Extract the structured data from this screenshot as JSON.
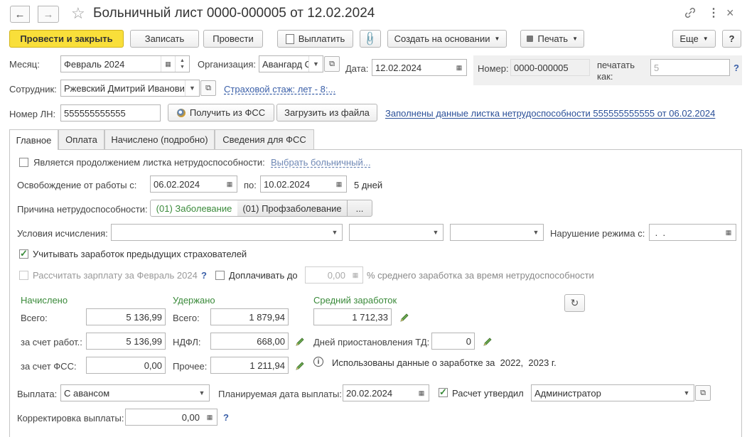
{
  "window": {
    "title": "Больничный лист 0000-000005 от 12.02.2024"
  },
  "toolbar": {
    "post_and_close": "Провести и закрыть",
    "save": "Записать",
    "post": "Провести",
    "pay": "Выплатить",
    "create_based_on": "Создать на основании",
    "print": "Печать",
    "more": "Еще",
    "help": "?"
  },
  "header": {
    "month_label": "Месяц:",
    "month_value": "Февраль 2024",
    "org_label": "Организация:",
    "org_value": "Авангард ООО",
    "date_label": "Дата:",
    "date_value": "12.02.2024",
    "number_label": "Номер:",
    "number_value": "0000-000005",
    "print_as_label_1": "печатать",
    "print_as_label_2": "как:",
    "print_as_value": "5",
    "print_as_help": "?",
    "employee_label": "Сотрудник:",
    "employee_value": "Ржевский Дмитрий Иванович",
    "insurance_link": "Страховой стаж: лет - 8:...",
    "ln_label": "Номер ЛН:",
    "ln_value": "555555555555",
    "get_from_fss": "Получить из ФСС",
    "load_from_file": "Загрузить из файла",
    "filled_link": "Заполнены данные листка нетрудоспособности 555555555555 от 06.02.2024"
  },
  "tabs": [
    "Главное",
    "Оплата",
    "Начислено (подробно)",
    "Сведения для ФСС"
  ],
  "main": {
    "continuation_label": "Является продолжением листка нетрудоспособности:",
    "choose_sick_link": "Выбрать больничный...",
    "release_label": "Освобождение от работы с:",
    "release_from": "06.02.2024",
    "to_label": "по:",
    "release_to": "10.02.2024",
    "days_text": "5 дней",
    "reason_label": "Причина нетрудоспособности:",
    "reason_1": "(01) Заболевание",
    "reason_2": "(01) Профзаболевание",
    "reason_more": "...",
    "conditions_label": "Условия исчисления:",
    "violation_label": "Нарушение режима с:",
    "violation_value": " .  .",
    "prev_insurers_label": "Учитывать заработок предыдущих страхователей",
    "calc_salary_label": "Рассчитать зарплату за Февраль 2024",
    "calc_salary_help": "?",
    "extra_pay_label": "Доплачивать до",
    "extra_pay_value": "0,00",
    "extra_pay_suffix": "% среднего заработка за время нетрудоспособности"
  },
  "totals": {
    "accrued_title": "Начислено",
    "withheld_title": "Удержано",
    "avg_title": "Средний заработок",
    "total_label": "Всего:",
    "total_value": "5 136,99",
    "employer_label": "за счет работ.:",
    "employer_value": "5 136,99",
    "fss_label": "за счет ФСС:",
    "fss_value": "0,00",
    "w_total_label": "Всего:",
    "w_total_value": "1 879,94",
    "ndfl_label": "НДФЛ:",
    "ndfl_value": "668,00",
    "other_label": "Прочее:",
    "other_value": "1 211,94",
    "avg_value": "1 712,33",
    "suspend_label": "Дней приостановления ТД:",
    "suspend_value": "0",
    "info_text": "Использованы данные о заработке за  2022,  2023 г."
  },
  "payment": {
    "payout_label": "Выплата:",
    "payout_value": "С авансом",
    "planned_label": "Планируемая дата выплаты:",
    "planned_value": "20.02.2024",
    "approved_label": "Расчет утвердил",
    "approved_value": "Администратор",
    "correction_label": "Корректировка выплаты:",
    "correction_value": "0,00",
    "correction_help": "?"
  },
  "colors": {
    "primary_button": "#f9df3a",
    "green_text": "#3a8a3a",
    "link": "#3a5fa8"
  }
}
